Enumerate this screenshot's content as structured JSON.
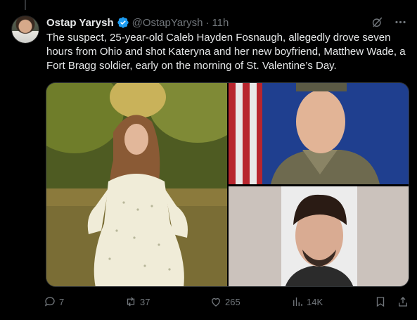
{
  "tweet": {
    "author_name": "Ostap Yarysh",
    "author_handle": "@OstapYarysh",
    "separator": "·",
    "time": "11h",
    "text": "The suspect, 25-year-old Caleb Hayden Fosnaugh, allegedly drove seven hours from Ohio and shot Kateryna and her new boyfriend, Matthew Wade, a Fort Bragg soldier, early on the morning of St. Valentine’s Day.",
    "verified_color": "#1d9bf0"
  },
  "actions": {
    "replies": "7",
    "reposts": "37",
    "likes": "265",
    "views": "14K"
  },
  "icons": [
    "grok-icon",
    "more-icon",
    "reply-icon",
    "repost-icon",
    "like-icon",
    "views-icon",
    "bookmark-icon",
    "share-icon",
    "verified-icon"
  ],
  "colors": {
    "background": "#000000",
    "text": "#e7e9ea",
    "muted": "#71767b",
    "accent": "#1d9bf0"
  }
}
